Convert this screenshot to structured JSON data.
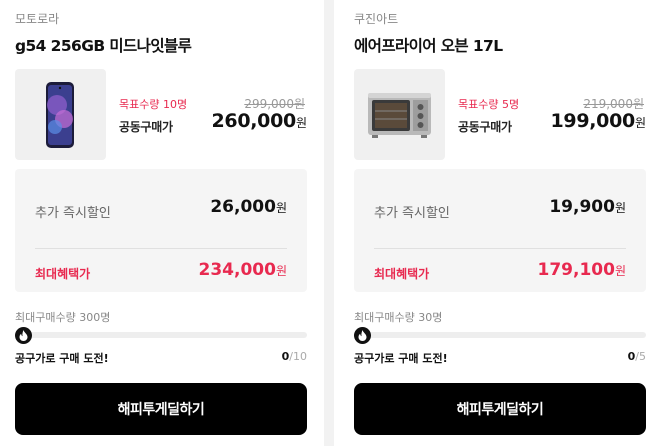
{
  "products": [
    {
      "brand": "모토로라",
      "title": "g54 256GB 미드나잇블루",
      "image": "smartphone-image",
      "target_label": "목표수량 10명",
      "group_buy_label": "공동구매가",
      "original_price": "299,000원",
      "price": "260,000",
      "price_unit": "원",
      "discount_label": "추가 즉시할인",
      "discount_value": "26,000",
      "discount_unit": "원",
      "max_benefit_label": "최대혜택가",
      "max_benefit_value": "234,000",
      "max_benefit_unit": "원",
      "max_purchase": "최대구매수량 300명",
      "progress": 0,
      "challenge_label": "공구가로 구매 도전!",
      "count_current": "0",
      "count_total": "/10",
      "button_label": "해피투게딜하기"
    },
    {
      "brand": "쿠진아트",
      "title": "에어프라이어 오븐 17L",
      "image": "air-fryer-oven-image",
      "target_label": "목표수량 5명",
      "group_buy_label": "공동구매가",
      "original_price": "219,000원",
      "price": "199,000",
      "price_unit": "원",
      "discount_label": "추가 즉시할인",
      "discount_value": "19,900",
      "discount_unit": "원",
      "max_benefit_label": "최대혜택가",
      "max_benefit_value": "179,100",
      "max_benefit_unit": "원",
      "max_purchase": "최대구매수량 30명",
      "progress": 0,
      "challenge_label": "공구가로 구매 도전!",
      "count_current": "0",
      "count_total": "/5",
      "button_label": "해피투게딜하기"
    }
  ],
  "colors": {
    "accent": "#e8294f",
    "button": "#000000",
    "panel": "#f5f5f5"
  }
}
